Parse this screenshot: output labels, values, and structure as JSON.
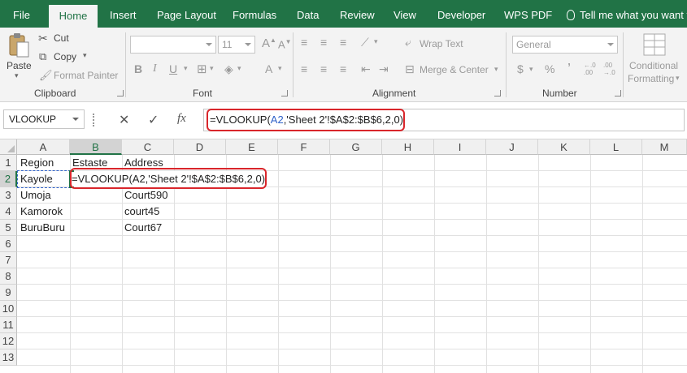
{
  "tabs": [
    "File",
    "Home",
    "Insert",
    "Page Layout",
    "Formulas",
    "Data",
    "Review",
    "View",
    "Developer",
    "WPS PDF"
  ],
  "tell_me": "Tell me what you want to",
  "ribbon": {
    "clipboard": {
      "paste": "Paste",
      "cut": "Cut",
      "copy": "Copy",
      "format_painter": "Format Painter",
      "label": "Clipboard"
    },
    "font": {
      "size": "11",
      "label": "Font"
    },
    "alignment": {
      "wrap_text": "Wrap Text",
      "merge_center": "Merge & Center",
      "label": "Alignment"
    },
    "number": {
      "format": "General",
      "label": "Number",
      "currency": "$",
      "percent": "%",
      "comma": "’",
      "inc_decimal": "←.0 .00",
      "dec_decimal": ".00 →.0"
    },
    "styles": {
      "conditional": "Conditional",
      "formatting": "Formatting"
    }
  },
  "formula_bar": {
    "name_box": "VLOOKUP",
    "cancel": "✕",
    "enter": "✓",
    "fx": "fx",
    "formula_prefix": "=VLOOKUP(",
    "formula_ref": "A2",
    "formula_rest": ",'Sheet 2'!$A$2:$B$6,2,0)"
  },
  "columns": [
    "A",
    "B",
    "C",
    "D",
    "E",
    "F",
    "G",
    "H",
    "I",
    "J",
    "K",
    "L",
    "M"
  ],
  "rows": [
    "1",
    "2",
    "3",
    "4",
    "5",
    "6",
    "7",
    "8",
    "9",
    "10",
    "11",
    "12",
    "13"
  ],
  "cells": {
    "A1": "Region",
    "B1": "Estaste",
    "C1": "Address",
    "A2": "Kayole",
    "B2": "=VLOOKUP(A2,'Sheet 2'!$A$2:$B$6,2,0)",
    "A3": "Umoja",
    "C3": "Court590",
    "A4": "Kamorok",
    "C4": "court45",
    "A5": "BuruBuru",
    "C5": "Court67"
  },
  "colors": {
    "brand": "#217346",
    "highlight": "#d9262b",
    "reference": "#2f62c9"
  }
}
